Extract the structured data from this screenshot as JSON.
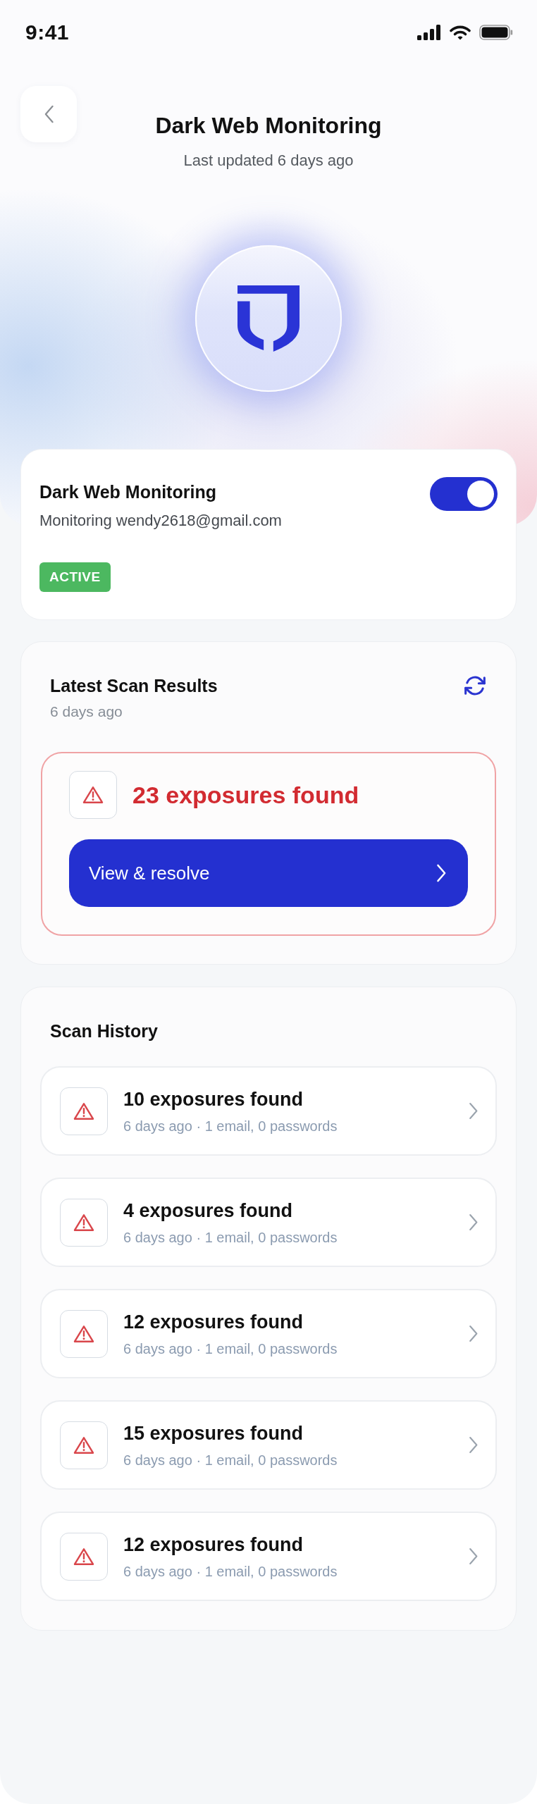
{
  "status_bar": {
    "time": "9:41"
  },
  "header": {
    "title": "Dark Web Monitoring",
    "subtitle": "Last updated 6 days ago"
  },
  "monitoring_card": {
    "title": "Dark Web Monitoring",
    "subtitle": "Monitoring wendy2618@gmail.com",
    "toggle": {
      "on": true
    },
    "status_badge": "ACTIVE"
  },
  "latest_scan": {
    "title": "Latest Scan Results",
    "subtitle": "6 days ago",
    "alert": "23 exposures found",
    "button": "View & resolve"
  },
  "scan_history": {
    "title": "Scan History",
    "items": [
      {
        "title": "10 exposures found",
        "subtitle": "6 days ago · 1 email, 0 passwords"
      },
      {
        "title": "4 exposures found",
        "subtitle": "6 days ago · 1 email, 0 passwords"
      },
      {
        "title": "12 exposures found",
        "subtitle": "6 days ago · 1 email, 0 passwords"
      },
      {
        "title": "15 exposures found",
        "subtitle": "6 days ago · 1 email, 0 passwords"
      },
      {
        "title": "12 exposures found",
        "subtitle": "6 days ago · 1 email, 0 passwords"
      }
    ]
  }
}
